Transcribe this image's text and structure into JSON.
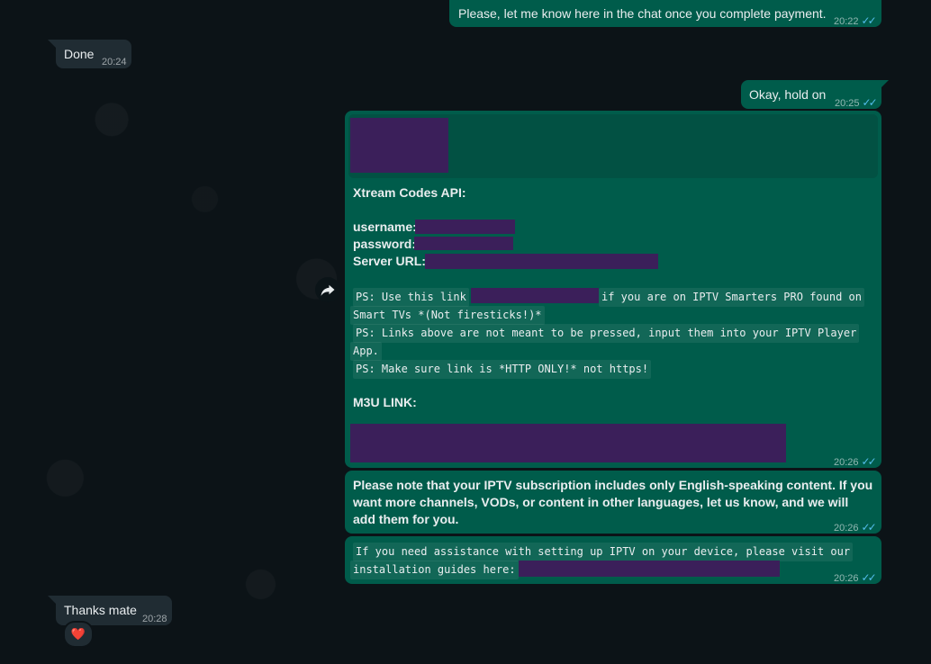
{
  "messages": {
    "m1": {
      "text": "Please, let me know here in the chat once you complete payment.",
      "time": "20:22"
    },
    "m2": {
      "text": "Done",
      "time": "20:24"
    },
    "m3": {
      "text": "Okay, hold on",
      "time": "20:25"
    },
    "m4": {
      "heading": "Xtream Codes API:",
      "username_label": "username:",
      "password_label": "password:",
      "server_label": "Server URL:",
      "ps1_a": "PS: Use this link",
      "ps1_b": "if you are on IPTV Smarters PRO found on",
      "ps1_c": "Smart TVs *(Not firesticks!)*",
      "ps2_a": "PS: Links above are not meant to be pressed, input them into your IPTV Player",
      "ps2_b": "App.",
      "ps3": "PS: Make sure link is *HTTP ONLY!* not https!",
      "m3u_label": "M3U LINK:",
      "time": "20:26"
    },
    "m5": {
      "line1": "Please note that your IPTV subscription includes only English-speaking content. If you",
      "line2": "want more channels, VODs, or content in other languages, let us know, and we will",
      "line3": "add them for you.",
      "time": "20:26"
    },
    "m6": {
      "line1": "If you need assistance with setting up IPTV on your device, please visit our",
      "line2": "installation guides here:",
      "time": "20:26"
    },
    "m7": {
      "text": "Thanks mate",
      "time": "20:28",
      "reaction": "❤️"
    }
  },
  "icons": {
    "read_ticks": "✓✓",
    "forward": "forward-icon"
  },
  "colors": {
    "outgoing": "#005c4b",
    "incoming": "#202c33",
    "background": "#0c1317",
    "ticks": "#53bdeb",
    "redaction": "#3b1f5a"
  }
}
